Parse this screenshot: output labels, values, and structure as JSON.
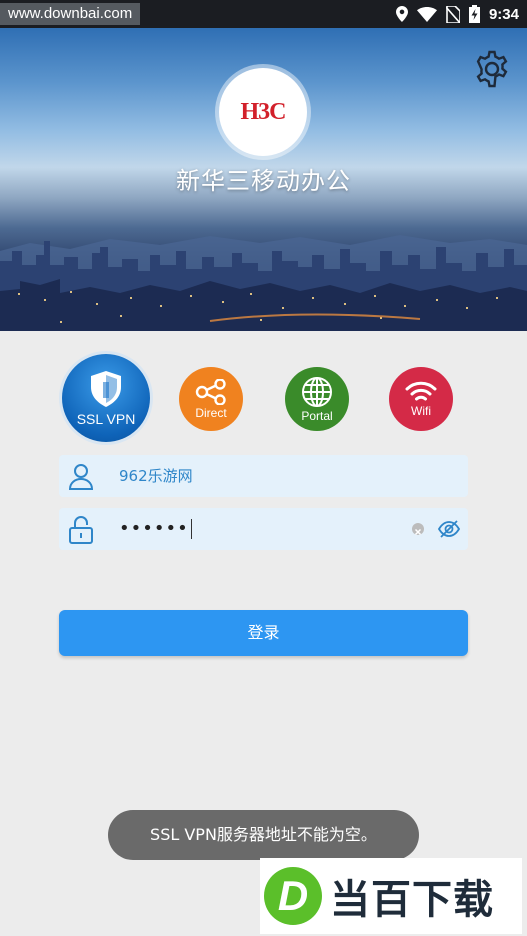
{
  "status_bar": {
    "watermark_url": "www.downbai.com",
    "time": "9:34"
  },
  "banner": {
    "logo_text": "H3C",
    "app_title": "新华三移动办公"
  },
  "modes": [
    {
      "label": "SSL VPN",
      "icon": "shield-icon",
      "color": "#1170c7"
    },
    {
      "label": "Direct",
      "icon": "share-icon",
      "color": "#f0821f"
    },
    {
      "label": "Portal",
      "icon": "globe-icon",
      "color": "#3a8b2a"
    },
    {
      "label": "Wifi",
      "icon": "wifi-icon",
      "color": "#d42a47"
    }
  ],
  "form": {
    "username_value": "962乐游网",
    "password_masked": "••••••"
  },
  "login_button": {
    "label": "登录",
    "color": "#2d96f2"
  },
  "toast": {
    "message": "SSL VPN服务器地址不能为空。"
  },
  "watermark": {
    "badge": "D",
    "text": "当百下载"
  }
}
